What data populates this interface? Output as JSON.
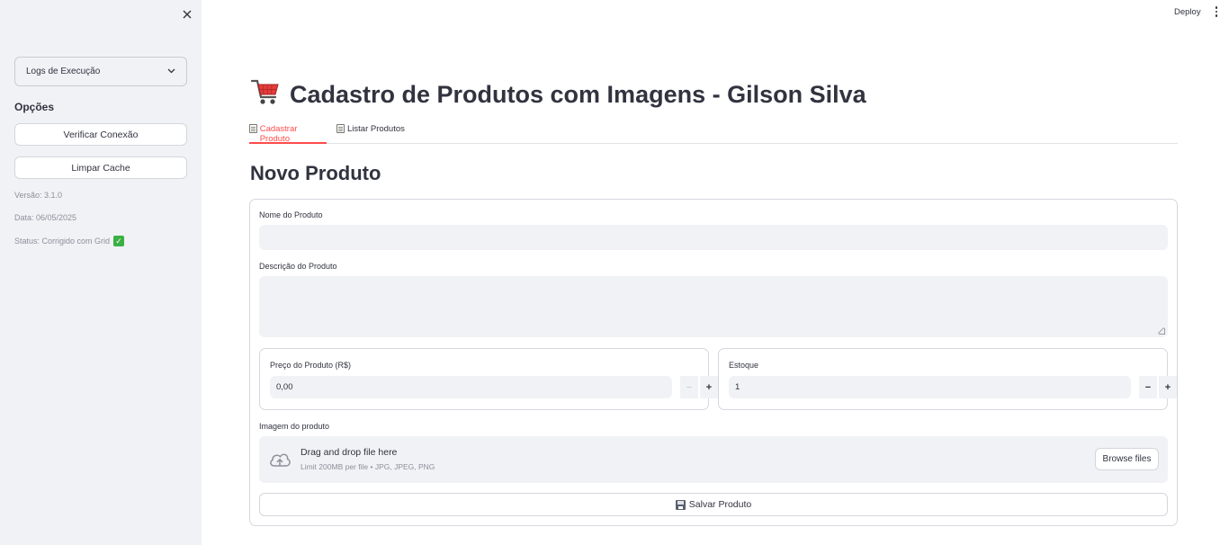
{
  "sidebar": {
    "select_value": "Logs de Execução",
    "options_title": "Opções",
    "buttons": {
      "verify": "Verificar Conexão",
      "clear_cache": "Limpar Cache"
    },
    "info": {
      "version": "Versão: 3.1.0",
      "date": "Data: 06/05/2025",
      "status": "Status: Corrigido com Grid"
    }
  },
  "header": {
    "deploy": "Deploy"
  },
  "main": {
    "title": "Cadastro de Produtos com Imagens - Gilson Silva",
    "tabs": [
      {
        "label": "Cadastrar Produto"
      },
      {
        "label": "Listar Produtos"
      }
    ],
    "section_title": "Novo Produto",
    "form": {
      "name_label": "Nome do Produto",
      "name_value": "",
      "description_label": "Descrição do Produto",
      "description_value": "",
      "price_label": "Preço do Produto (R$)",
      "price_value": "0,00",
      "stock_label": "Estoque",
      "stock_value": "1",
      "image_label": "Imagem do produto",
      "upload_main": "Drag and drop file here",
      "upload_sub": "Limit 200MB per file • JPG, JPEG, PNG",
      "browse_label": "Browse files",
      "save_label": "Salvar Produto"
    }
  },
  "colors": {
    "accent": "#ff4b4b",
    "sidebar_bg": "#f0f2f6",
    "text": "#31333f",
    "muted": "#8d909a",
    "check": "#3cb043"
  }
}
